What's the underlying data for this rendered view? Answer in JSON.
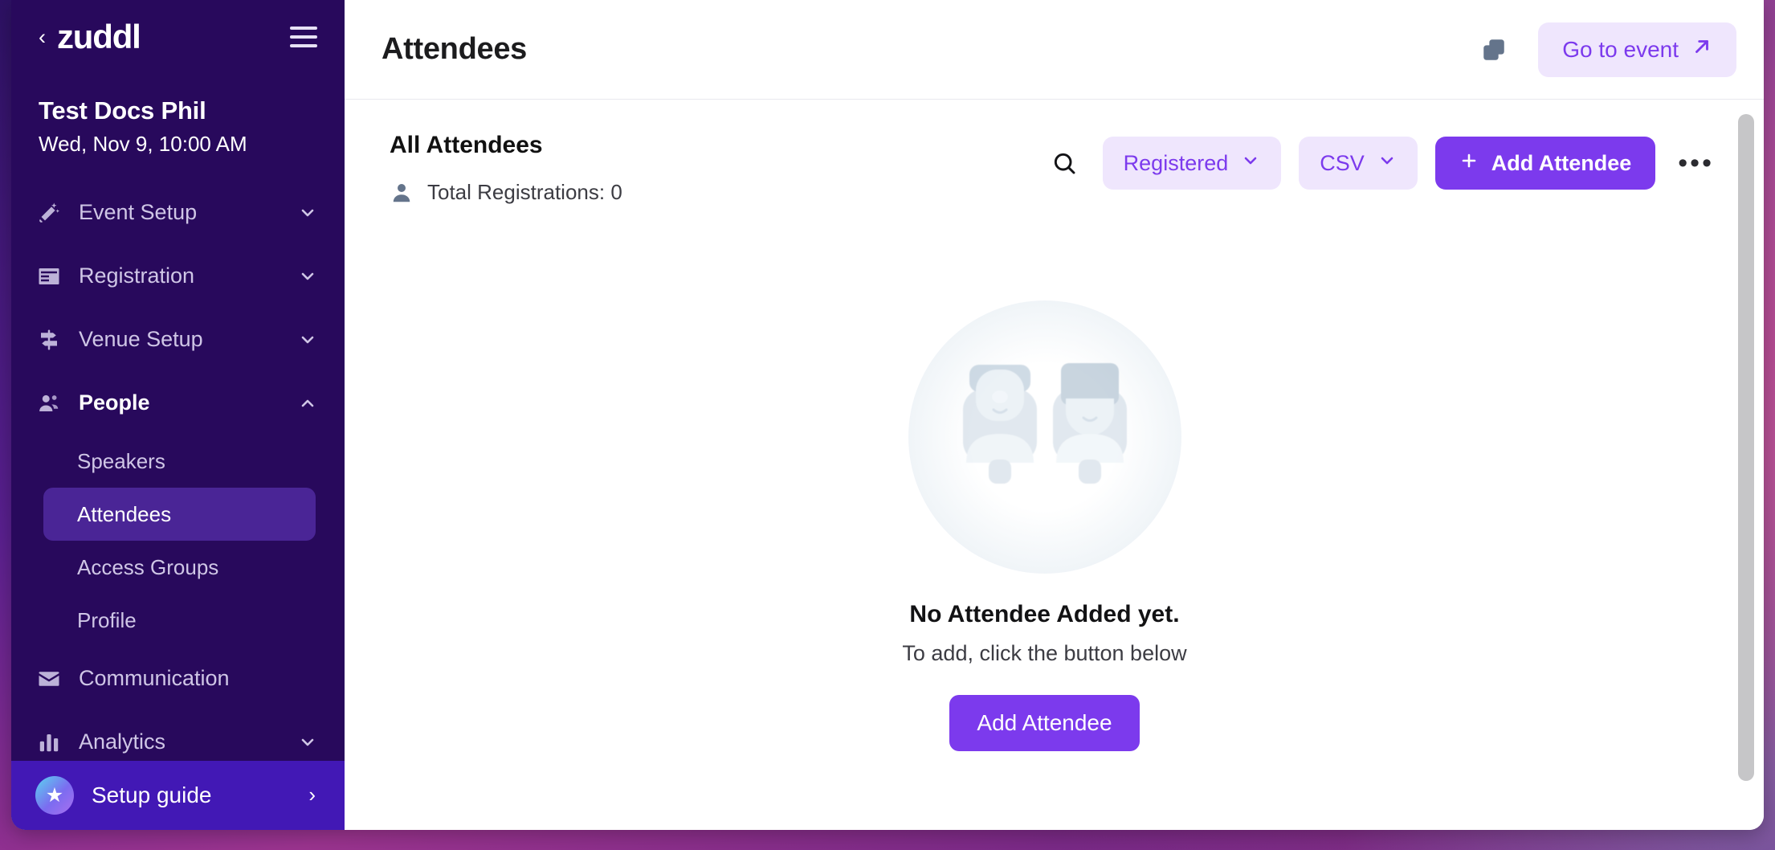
{
  "sidebar": {
    "back_icon": "chevron-left-icon",
    "brand": "zuddl",
    "menu_icon": "hamburger-icon",
    "event_name": "Test Docs Phil",
    "event_datetime": "Wed, Nov 9, 10:00 AM",
    "nav": [
      {
        "label": "Event Setup",
        "icon": "magic-wand-icon",
        "chevron": "chevron-down",
        "expanded": false
      },
      {
        "label": "Registration",
        "icon": "form-icon",
        "chevron": "chevron-down",
        "expanded": false
      },
      {
        "label": "Venue Setup",
        "icon": "signpost-icon",
        "chevron": "chevron-down",
        "expanded": false
      },
      {
        "label": "People",
        "icon": "people-icon",
        "chevron": "chevron-up",
        "expanded": true
      },
      {
        "label": "Communication",
        "icon": "envelope-icon",
        "chevron": "",
        "expanded": false
      },
      {
        "label": "Analytics",
        "icon": "bar-chart-icon",
        "chevron": "chevron-down",
        "expanded": false
      }
    ],
    "people_subitems": [
      {
        "label": "Speakers",
        "selected": false
      },
      {
        "label": "Attendees",
        "selected": true
      },
      {
        "label": "Access Groups",
        "selected": false
      },
      {
        "label": "Profile",
        "selected": false
      }
    ],
    "setup_guide": {
      "label": "Setup guide",
      "badge_icon": "star-icon",
      "chevron": "chevron-right-icon"
    },
    "colors": {
      "background": "#28095C",
      "selected_item": "#4A2596",
      "setup_guide_bar": "#4218B5"
    }
  },
  "topbar": {
    "title": "Attendees",
    "copy_icon": "duplicate-icon",
    "go_to_event_label": "Go to event",
    "go_to_event_icon": "arrow-up-right-icon"
  },
  "toolbar": {
    "heading": "All Attendees",
    "total_icon": "person-icon",
    "total_registrations": "Total Registrations: 0",
    "search_icon": "search-icon",
    "status_filter": {
      "value": "Registered",
      "icon": "chevron-down-icon"
    },
    "export_format": {
      "value": "CSV",
      "icon": "chevron-down-icon"
    },
    "add_attendee_label": "Add Attendee",
    "add_attendee_icon": "plus-icon",
    "more_menu": "•••"
  },
  "empty_state": {
    "illustration": "two-people-illustration",
    "title": "No Attendee Added yet.",
    "subtitle": "To add, click the button below",
    "cta_label": "Add Attendee"
  },
  "theme": {
    "accent": "#7C3AED",
    "accent_soft": "#EFE6FD",
    "sidebar_bg": "#28095C",
    "text_dark": "#111114"
  }
}
